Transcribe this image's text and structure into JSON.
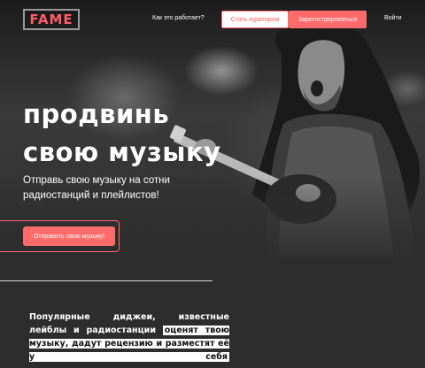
{
  "header": {
    "logo_text": "FAME",
    "nav_how": "Как это работает?",
    "curator_label": "Стать куратором",
    "register_label": "Зарегистрироваться",
    "login_label": "Войти"
  },
  "hero": {
    "headline_line1": "продвинь",
    "headline_line2": "свою музыку",
    "subtitle": "Отправь свою музыку на сотни радиостанций и плейлистов!",
    "cta_label": "Отправить свою музыку!"
  },
  "features": {
    "intro_plain": "Популярные диджеи, известные лейблы и радиостанции ",
    "intro_highlight": "оценят твою музыку, дадут рецензию и разместят её у себя"
  },
  "colors": {
    "accent": "#ff6b6b",
    "background": "#2d2d2d",
    "text": "#ffffff"
  },
  "icons": {
    "logo": "fame-logo"
  }
}
